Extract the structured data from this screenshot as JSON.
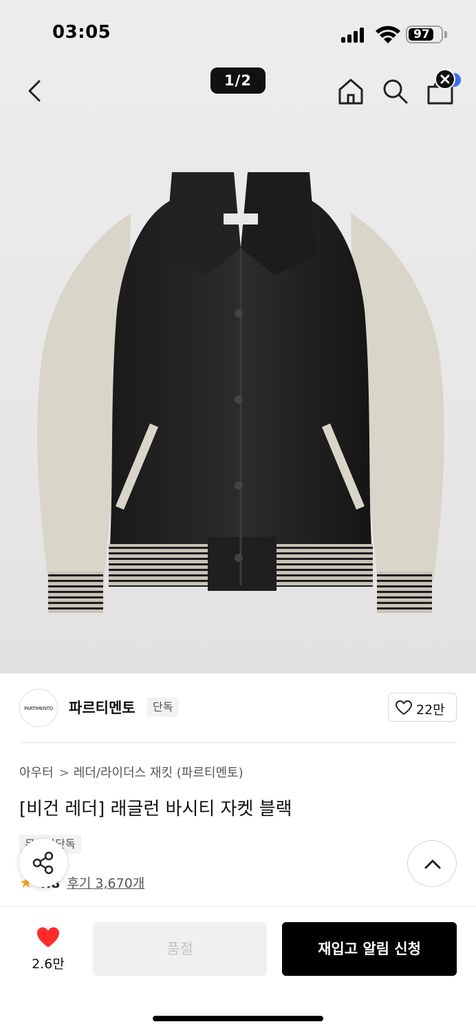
{
  "status_bar": {
    "time": "03:05",
    "battery": "97"
  },
  "nav": {
    "image_counter": "1/2"
  },
  "brand": {
    "logo_text": "PARTIMENTO",
    "name": "파르티멘토",
    "badge": "단독",
    "like_count": "22만"
  },
  "product": {
    "breadcrumb": [
      "아우터",
      "레더/라이더스 재킷 (파르티멘토)"
    ],
    "title": "[비건 레더] 래글런 바시티 자켓 블랙",
    "tag": "무신사단독",
    "rating": "4.8",
    "reviews": "후기 3,670개"
  },
  "bottom": {
    "wish_count": "2.6만",
    "soldout_label": "품절",
    "restock_label": "재입고 알림 신청"
  },
  "colors": {
    "accent_heart": "#ff2b2b",
    "primary_button": "#000000",
    "disabled_button": "#f0f0f0",
    "star": "#f5a623"
  }
}
